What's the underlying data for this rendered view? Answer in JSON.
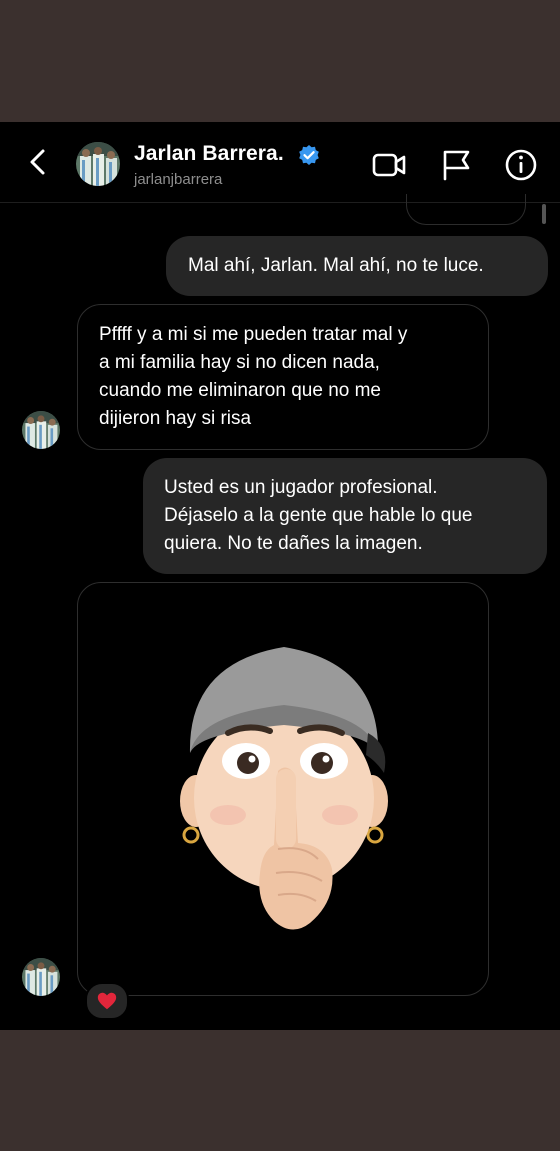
{
  "header": {
    "name": "Jarlan Barrera.",
    "username": "jarlanjbarrera",
    "icons": [
      "back-chevron-icon",
      "verified-badge-icon",
      "video-call-icon",
      "flag-icon",
      "info-icon"
    ]
  },
  "messages": [
    {
      "type": "sent",
      "text": "Mal ahí, Jarlan. Mal ahí, no te luce."
    },
    {
      "type": "received",
      "text": "Pffff y a mi si me pueden tratar mal y\na mi familia hay si no dicen nada,\ncuando me eliminaron que no me\ndijieron hay si risa"
    },
    {
      "type": "sent",
      "text": "Usted es un jugador profesional.\nDéjaselo a la gente que hable lo que\nquiera. No te dañes la imagen."
    },
    {
      "type": "received-sticker",
      "sticker": "memoji-shush-sticker",
      "reaction": "❤️"
    }
  ],
  "colors": {
    "background": "#000000",
    "sent_bubble": "#262626",
    "verified": "#3897f0",
    "outer": "#3b302e"
  }
}
